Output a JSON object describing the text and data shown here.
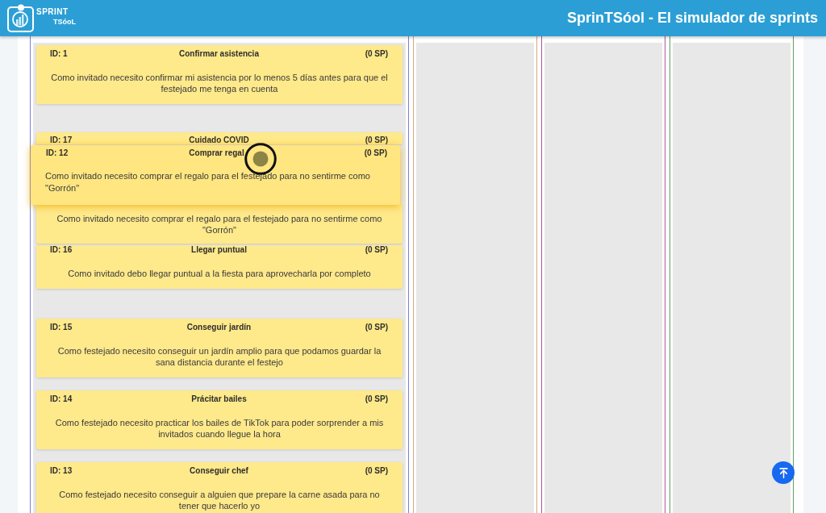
{
  "header": {
    "logo": {
      "line_1": "SPRINT",
      "line_2": "TSóoL"
    },
    "title": "SprinTSóol - El simulador de sprints"
  },
  "columns": [
    {
      "color": "#7f7fd6",
      "cards": [
        {
          "id": "ID: 1",
          "title": "Confirmar asistencia",
          "points": "(0 SP)",
          "description": "Como invitado necesito confirmar mi asistencia por lo menos 5 días antes para que el festejado me tenga en cuenta",
          "dragging": false
        },
        {
          "id": "ID: 17",
          "title": "Cuidado COVID",
          "points": "(0 SP)",
          "dragging": false
        },
        {
          "id": "ID: 12",
          "title": "Comprar regal",
          "points": "(0 SP)",
          "description": "Como invitado necesito comprar el regalo para el festejado para no sentirme como \"Gorrón\"",
          "dragging": true
        },
        {
          "description": "Como invitado necesito comprar el regalo para el festejado para no sentirme como \"Gorrón\"",
          "dragging": false
        },
        {
          "id": "ID: 16",
          "title": "Llegar puntual",
          "points": "(0 SP)",
          "description": "Como invitado debo llegar puntual a la fiesta para aprovecharla por completo",
          "dragging": false
        },
        {
          "id": "ID: 15",
          "title": "Conseguir jardín",
          "points": "(0 SP)",
          "description": "Como festejado necesito conseguir un jardín amplio para que podamos guardar la sana distancia durante el festejo",
          "dragging": false
        },
        {
          "id": "ID: 14",
          "title": "Prácitar bailes",
          "points": "(0 SP)",
          "description": "Como festejado necesito practicar los bailes de TikTok para poder sorprender a mis invitados cuando llegue la hora",
          "dragging": false
        },
        {
          "id": "ID: 13",
          "title": "Conseguir chef",
          "points": "(0 SP)",
          "description": "Como festejado necesito conseguir a alguien que prepare la carne asada para no tener que hacerlo yo",
          "dragging": false
        }
      ]
    },
    {
      "color": "#d9a87c"
    },
    {
      "color": "#a8599e"
    },
    {
      "color": "#5f9f62"
    }
  ]
}
